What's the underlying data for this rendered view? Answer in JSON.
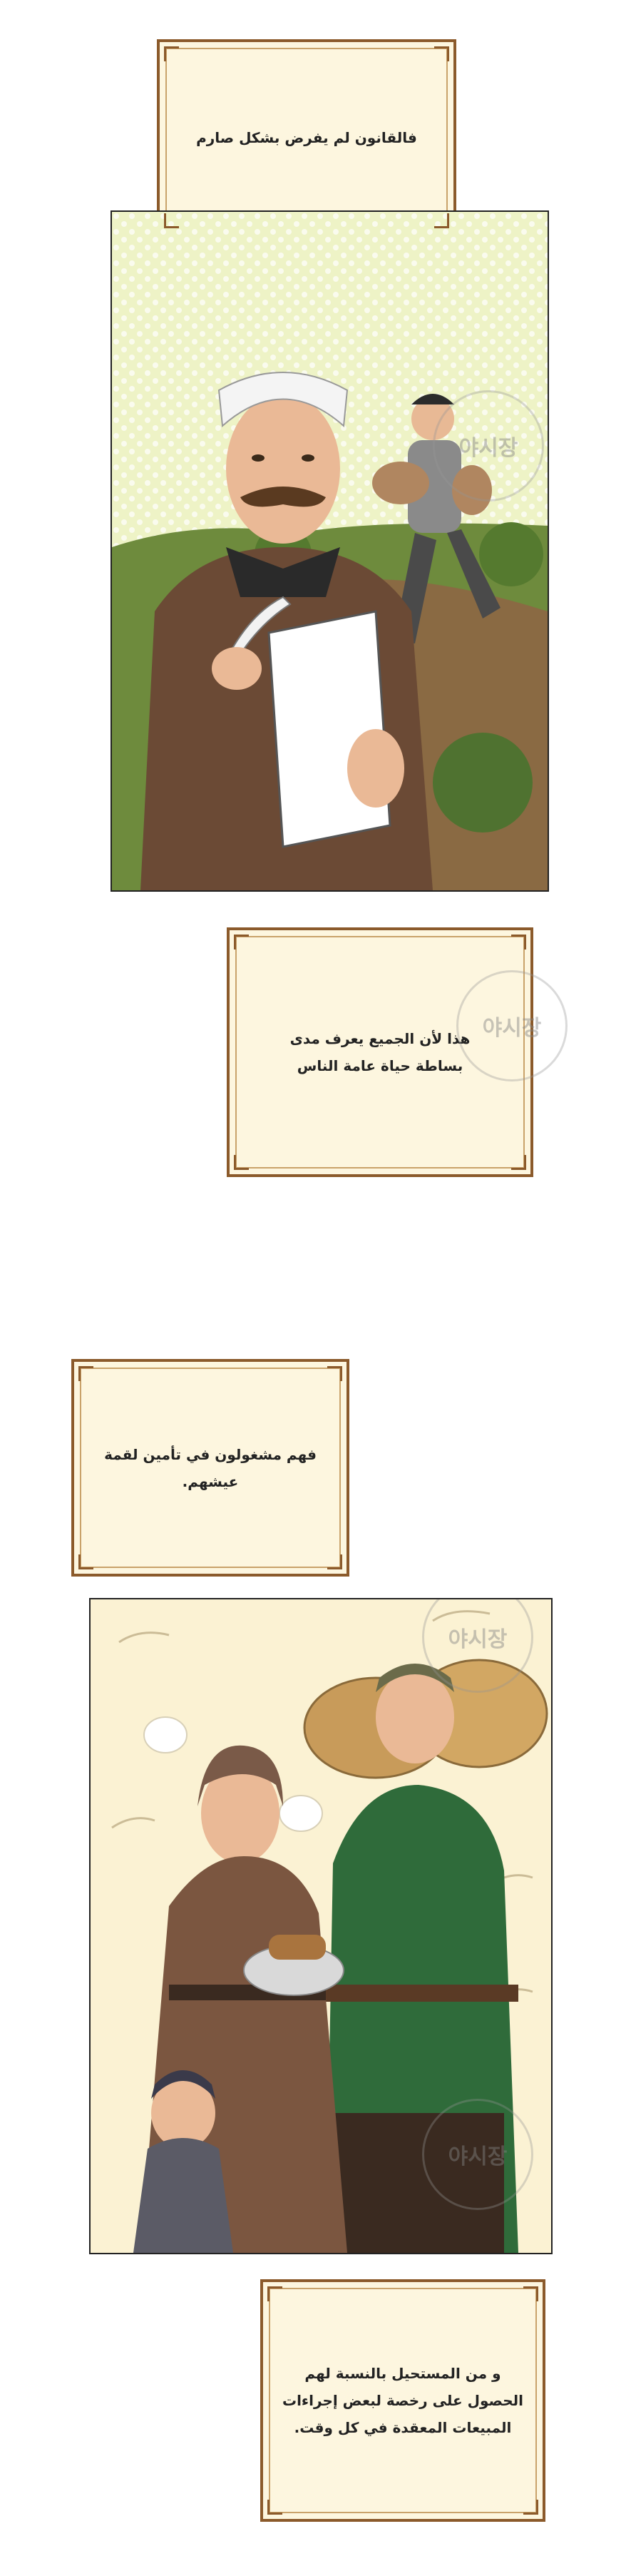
{
  "captions": [
    {
      "text": "فالقانون لم يفرض بشكل صارم"
    },
    {
      "text": "هذا لأن الجميع  يعرف مدى\nبساطة حياة عامة الناس"
    },
    {
      "text": "فهم مشغولون في تأمين لقمة\nعيشهم."
    },
    {
      "text": "و من المستحيل بالنسبة لهم\nالحصول على رخصة لبعض إجراءات\nالمبيعات المعقدة في كل وقت."
    }
  ],
  "watermark": {
    "text": "야시장"
  },
  "colors": {
    "frame": "#8b5a2b",
    "caption_bg": "#fdf6df",
    "panel1_bg": "#eef3c6",
    "panel2_bg": "#fbf2d3",
    "robe": "#6b4a35",
    "shirt": "#2f6b3a"
  }
}
